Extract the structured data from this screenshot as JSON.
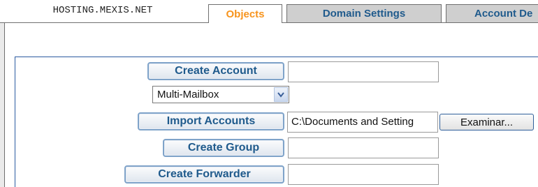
{
  "tabs": {
    "host": "HOSTING.MEXIS.NET",
    "objects": "Objects",
    "domain_settings": "Domain Settings",
    "account_defaults": "Account De"
  },
  "form": {
    "create_account_label": "Create Account",
    "account_type_selected": "Multi-Mailbox",
    "import_accounts_label": "Import Accounts",
    "import_path_value": "C:\\Documents and Setting",
    "browse_label": "Examinar...",
    "create_group_label": "Create Group",
    "create_forwarder_label": "Create Forwarder"
  },
  "icons": {
    "select_arrow": "chevron-down-icon"
  },
  "colors": {
    "active_tab": "#f7941d",
    "tab_text": "#1f5a8c",
    "inactive_tab_bg": "#cfcfcf",
    "frame_blue": "#2b5aa0"
  }
}
